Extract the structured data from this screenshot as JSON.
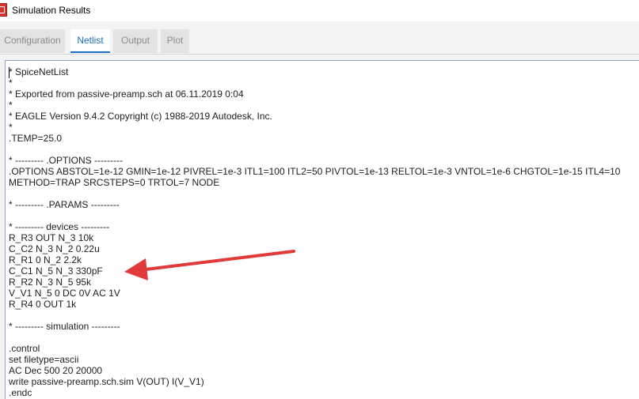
{
  "window": {
    "title": "Simulation Results",
    "icon": "eagle-app-icon"
  },
  "tabs": [
    {
      "label": "Configuration",
      "active": false
    },
    {
      "label": "Netlist",
      "active": true
    },
    {
      "label": "Output",
      "active": false
    },
    {
      "label": "Plot",
      "active": false
    }
  ],
  "netlist": {
    "lines": [
      "* SpiceNetList",
      "*",
      "* Exported from passive-preamp.sch at 06.11.2019 0:04",
      "*",
      "* EAGLE Version 9.4.2 Copyright (c) 1988-2019 Autodesk, Inc.",
      "*",
      ".TEMP=25.0",
      "",
      "* --------- .OPTIONS ---------",
      ".OPTIONS ABSTOL=1e-12 GMIN=1e-12 PIVREL=1e-3 ITL1=100 ITL2=50 PIVTOL=1e-13 RELTOL=1e-3 VNTOL=1e-6 CHGTOL=1e-15 ITL4=10",
      "METHOD=TRAP SRCSTEPS=0 TRTOL=7 NODE",
      "",
      "* --------- .PARAMS ---------",
      "",
      "* --------- devices ---------",
      "R_R3 OUT N_3 10k",
      "C_C2 N_3 N_2 0.22u",
      "R_R1 0 N_2 2.2k",
      "C_C1 N_5 N_3 330pF",
      "R_R2 N_3 N_5 95k",
      "V_V1 N_5 0 DC 0V AC 1V",
      "R_R4 0 OUT 1k",
      "",
      "* --------- simulation ---------",
      "",
      ".control",
      "set filetype=ascii",
      "AC Dec 500 20 20000",
      "write passive-preamp.sch.sim V(OUT) I(V_V1)",
      ".endc"
    ]
  },
  "annotation": {
    "type": "arrow",
    "color": "#e03a3a"
  }
}
